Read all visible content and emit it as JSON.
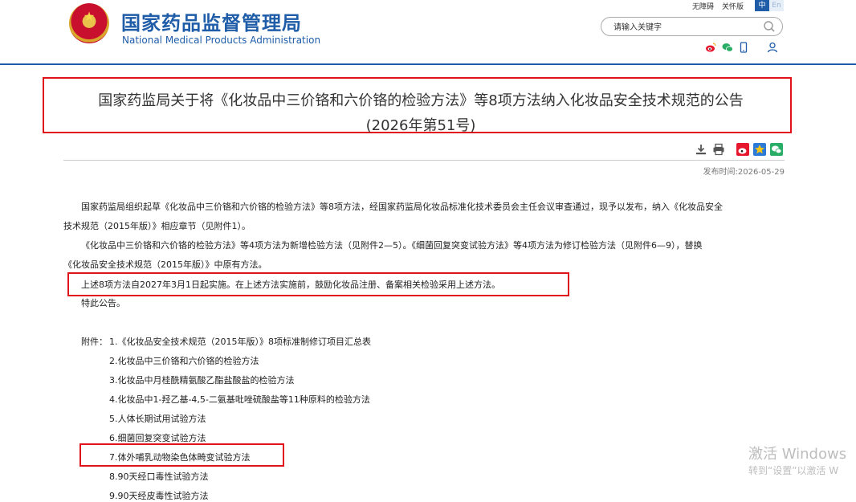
{
  "header": {
    "site_title": "国家药品监督管理局",
    "site_subtitle": "National Medical Products Administration",
    "links": [
      "无障碍",
      "关怀版"
    ],
    "lang_zh": "中",
    "lang_en": "En",
    "search_placeholder": "请输入关键字",
    "social_icons": [
      "weibo-icon",
      "wechat-icon",
      "mobile-icon",
      "user-icon"
    ]
  },
  "article": {
    "title_line1": "国家药监局关于将《化妆品中三价铬和六价铬的检验方法》等8项方法纳入化妆品安全技术规范的公告",
    "title_line2": "(2026年第51号)",
    "publish_label": "发布时间:",
    "publish_date": "2026-05-29",
    "para1_line1": "国家药监局组织起草《化妆品中三价铬和六价铬的检验方法》等8项方法，经国家药监局化妆品标准化技术委员会主任会议审查通过，现予以发布，纳入《化妆品安全",
    "para1_line2": "技术规范（2015年版）》相应章节（见附件1）。",
    "para2_line1": "《化妆品中三价铬和六价铬的检验方法》等4项方法为新增检验方法（见附件2—5）。《细菌回复突变试验方法》等4项方法为修订检验方法（见附件6—9），替换",
    "para2_line2": "《化妆品安全技术规范（2015年版）》中原有方法。",
    "para3": "上述8项方法自2027年3月1日起实施。在上述方法实施前，鼓励化妆品注册、备案相关检验采用上述方法。",
    "para4": "特此公告。",
    "attachments_label": "附件：",
    "attachments": [
      "1.《化妆品安全技术规范（2015年版）》8项标准制修订项目汇总表",
      "2.化妆品中三价铬和六价铬的检验方法",
      "3.化妆品中月桂酰精氨酸乙酯盐酸盐的检验方法",
      "4.化妆品中1-羟乙基-4,5-二氨基吡唑硫酸盐等11种原料的检验方法",
      "5.人体长期试用试验方法",
      "6.细菌回复突变试验方法",
      "7.体外哺乳动物染色体畸变试验方法",
      "8.90天经口毒性试验方法",
      "9.90天经皮毒性试验方法"
    ]
  },
  "watermark": {
    "line1": "激活 Windows",
    "line2": "转到“设置”以激活 W"
  },
  "colors": {
    "brand": "#1f5da8",
    "highlight": "#e0121a"
  }
}
